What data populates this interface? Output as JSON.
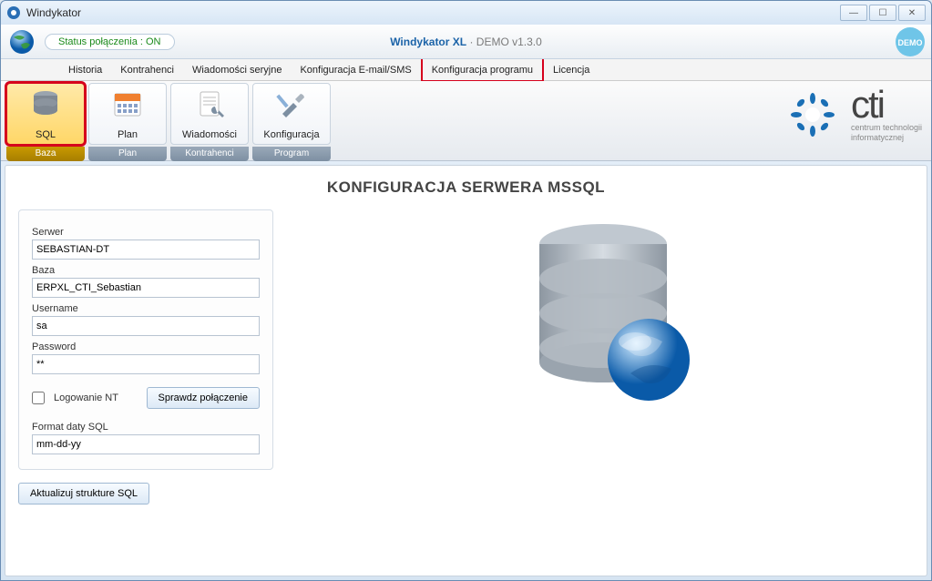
{
  "window": {
    "title": "Windykator"
  },
  "header": {
    "status_label": "Status połączenia : ON",
    "app_title_strong": "Windykator XL",
    "app_title_rest": " · DEMO v1.3.0",
    "demo_badge": "DEMO"
  },
  "menubar": {
    "items": [
      {
        "label": "Historia"
      },
      {
        "label": "Kontrahenci"
      },
      {
        "label": "Wiadomości seryjne"
      },
      {
        "label": "Konfiguracja E-mail/SMS"
      },
      {
        "label": "Konfiguracja programu",
        "highlighted": true
      },
      {
        "label": "Licencja"
      }
    ]
  },
  "ribbon": {
    "groups": [
      {
        "footer": "Baza",
        "active": true,
        "buttons": [
          {
            "label": "SQL",
            "icon": "database-icon",
            "active": true
          }
        ]
      },
      {
        "footer": "Plan",
        "buttons": [
          {
            "label": "Plan",
            "icon": "calendar-icon"
          }
        ]
      },
      {
        "footer": "Kontrahenci",
        "buttons": [
          {
            "label": "Wiadomości",
            "icon": "wrench-page-icon"
          }
        ]
      },
      {
        "footer": "Program",
        "buttons": [
          {
            "label": "Konfiguracja",
            "icon": "tools-icon"
          }
        ]
      }
    ]
  },
  "logo": {
    "brand": "cti",
    "sub1": "centrum technologii",
    "sub2": "informatycznej"
  },
  "section": {
    "title": "KONFIGURACJA SERWERA MSSQL"
  },
  "form": {
    "server_label": "Serwer",
    "server_value": "SEBASTIAN-DT",
    "db_label": "Baza",
    "db_value": "ERPXL_CTI_Sebastian",
    "user_label": "Username",
    "user_value": "sa",
    "pass_label": "Password",
    "pass_value": "**",
    "nt_label": "Logowanie NT",
    "test_btn": "Sprawdz połączenie",
    "datefmt_label": "Format daty SQL",
    "datefmt_value": "mm-dd-yy",
    "update_btn": "Aktualizuj strukture SQL"
  }
}
